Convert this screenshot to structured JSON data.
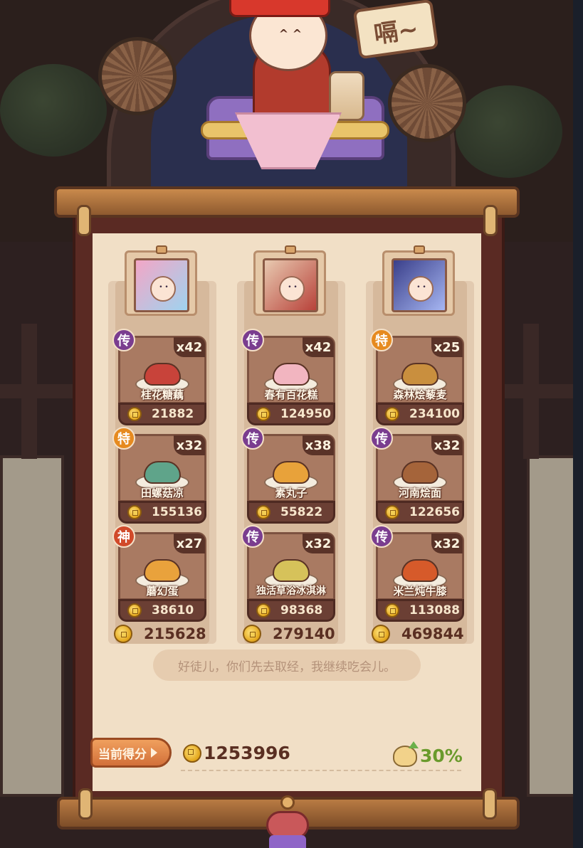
{
  "banner_sign": "嗝~",
  "columns": [
    {
      "portrait": "character-1",
      "total": "215628",
      "dishes": [
        {
          "badge": "传",
          "badge_type": "legendary",
          "qty": "x42",
          "name": "桂花糖藕",
          "value": "21882",
          "food_color": "#c8433a"
        },
        {
          "badge": "特",
          "badge_type": "special",
          "qty": "x32",
          "name": "田螺菇凉",
          "value": "155136",
          "food_color": "#5fa48a"
        },
        {
          "badge": "神",
          "badge_type": "divine",
          "qty": "x27",
          "name": "蘑幻蛋",
          "value": "38610",
          "food_color": "#e9a23c"
        }
      ]
    },
    {
      "portrait": "character-2",
      "total": "279140",
      "dishes": [
        {
          "badge": "传",
          "badge_type": "legendary",
          "qty": "x42",
          "name": "春有百花糕",
          "value": "124950",
          "food_color": "#f2b5c0"
        },
        {
          "badge": "传",
          "badge_type": "legendary",
          "qty": "x38",
          "name": "素丸子",
          "value": "55822",
          "food_color": "#e8a23a"
        },
        {
          "badge": "传",
          "badge_type": "legendary",
          "qty": "x32",
          "name": "独活草浴冰淇淋",
          "value": "98368",
          "food_color": "#d6c25a"
        }
      ]
    },
    {
      "portrait": "character-3",
      "total": "469844",
      "dishes": [
        {
          "badge": "特",
          "badge_type": "special",
          "qty": "x25",
          "name": "森林烩藜麦",
          "value": "234100",
          "food_color": "#c98f3e"
        },
        {
          "badge": "传",
          "badge_type": "legendary",
          "qty": "x32",
          "name": "河南烩面",
          "value": "122656",
          "food_color": "#a5643a"
        },
        {
          "badge": "传",
          "badge_type": "legendary",
          "qty": "x32",
          "name": "米兰炖牛膝",
          "value": "113088",
          "food_color": "#d65a2a"
        }
      ]
    }
  ],
  "message": "好徒儿，你们先去取经，我继续吃会儿。",
  "score": {
    "label": "当前得分",
    "value": "1253996",
    "bonus": "30%"
  },
  "colors": {
    "legendary": "#7a3d8f",
    "special": "#e68a1f",
    "divine": "#d14a2a",
    "bonus_green": "#6a9a2c"
  }
}
